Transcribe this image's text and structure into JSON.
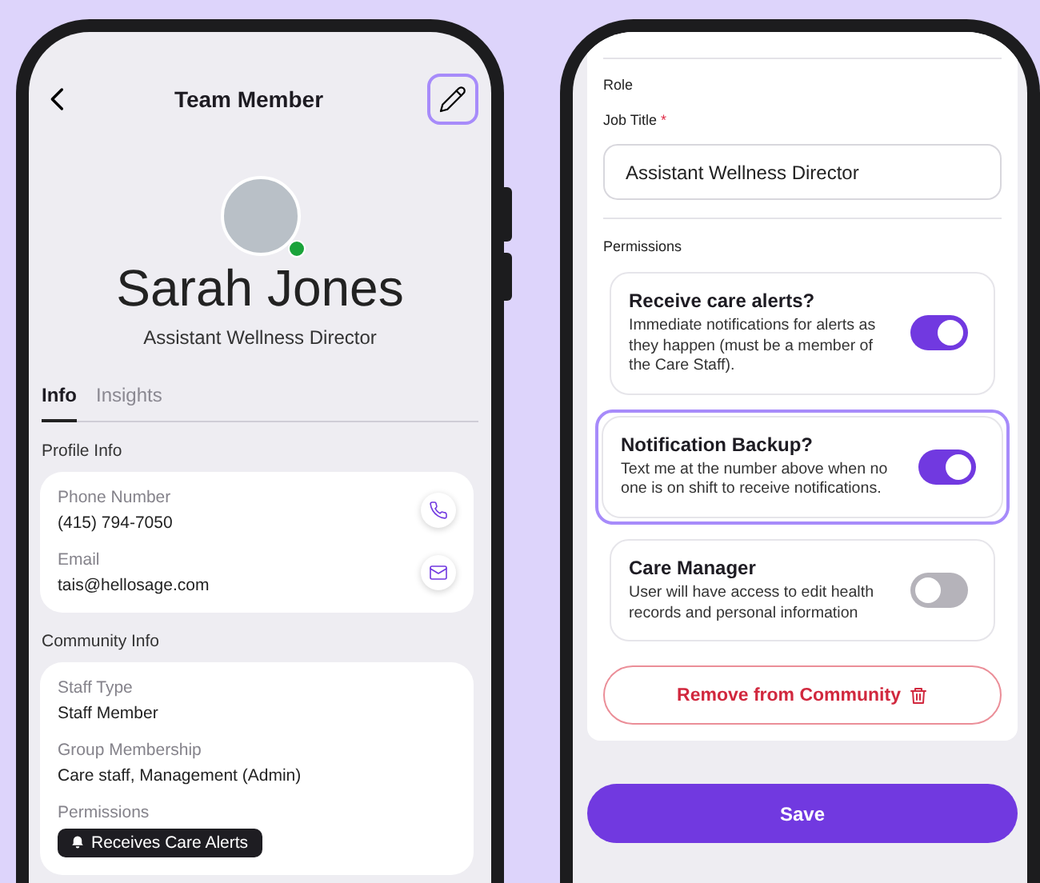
{
  "profile_screen": {
    "title": "Team Member",
    "edit_highlighted": true,
    "avatar_online": true,
    "name": "Sarah Jones",
    "job_title": "Assistant Wellness Director",
    "tabs": [
      {
        "label": "Info",
        "selected": true
      },
      {
        "label": "Insights",
        "selected": false
      }
    ],
    "sections": [
      {
        "title": "Profile Info",
        "fields": [
          {
            "label": "Phone Number",
            "value": "(415) 794-7050",
            "kind": "phone"
          },
          {
            "label": "Email",
            "value": "tais@hellosage.com",
            "kind": "email"
          }
        ]
      },
      {
        "title": "Community Info",
        "fields": [
          {
            "label": "Staff Type",
            "value": "Staff Member"
          },
          {
            "label": "Group Membership",
            "value": "Care staff, Management (Admin)"
          },
          {
            "label": "Permissions",
            "badge": "Receives Care Alerts"
          }
        ]
      }
    ]
  },
  "edit_screen": {
    "role_heading": "Role",
    "job_title_field": {
      "label": "Job Title",
      "required_mark": "*",
      "value": "Assistant Wellness Director"
    },
    "permissions_heading": "Permissions",
    "toggles": [
      {
        "title": "Receive care alerts?",
        "description": "Immediate notifications for alerts as they happen (must be a member of the Care Staff).",
        "on": true,
        "highlighted": false
      },
      {
        "title": "Notification Backup?",
        "description": "Text me at the number above when no one is on shift to receive notifications.",
        "on": true,
        "highlighted": true
      },
      {
        "title": "Care Manager",
        "description": "User will have access to edit health records and personal information",
        "on": false,
        "highlighted": false
      }
    ],
    "remove_button": "Remove from Community",
    "save_button": "Save"
  }
}
